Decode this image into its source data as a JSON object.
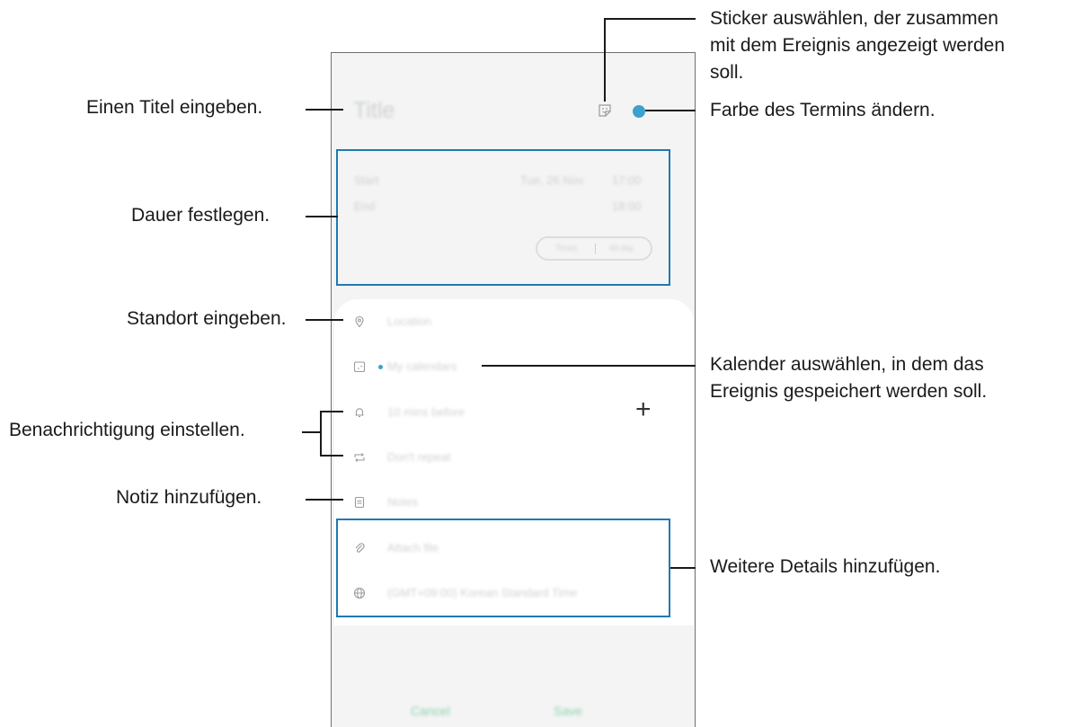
{
  "screen": {
    "title_placeholder": "Title",
    "start_label": "Start",
    "start_date": "Tue, 26 Nov",
    "start_time": "17:00",
    "end_label": "End",
    "end_time": "18:00",
    "toggle_times": "Times",
    "toggle_allday": "All day",
    "location": "Location",
    "calendar": "My calendars",
    "notification": "10 mins before",
    "repeat": "Don't repeat",
    "notes": "Notes",
    "attach": "Attach file",
    "timezone": "(GMT+09:00) Korean Standard Time",
    "cancel": "Cancel",
    "save": "Save",
    "add_symbol": "+",
    "event_color": "#3ea0cc"
  },
  "annotations": {
    "title": "Einen Titel eingeben.",
    "duration": "Dauer festlegen.",
    "location": "Standort eingeben.",
    "notification": "Benachrichtigung einstellen.",
    "notes": "Notiz hinzufügen.",
    "sticker_line1": "Sticker auswählen, der zusammen",
    "sticker_line2": "mit dem Ereignis angezeigt werden",
    "sticker_line3": "soll.",
    "color": "Farbe des Termins ändern.",
    "calendar_line1": "Kalender auswählen, in dem das",
    "calendar_line2": "Ereignis gespeichert werden soll.",
    "details": "Weitere Details hinzufügen."
  }
}
